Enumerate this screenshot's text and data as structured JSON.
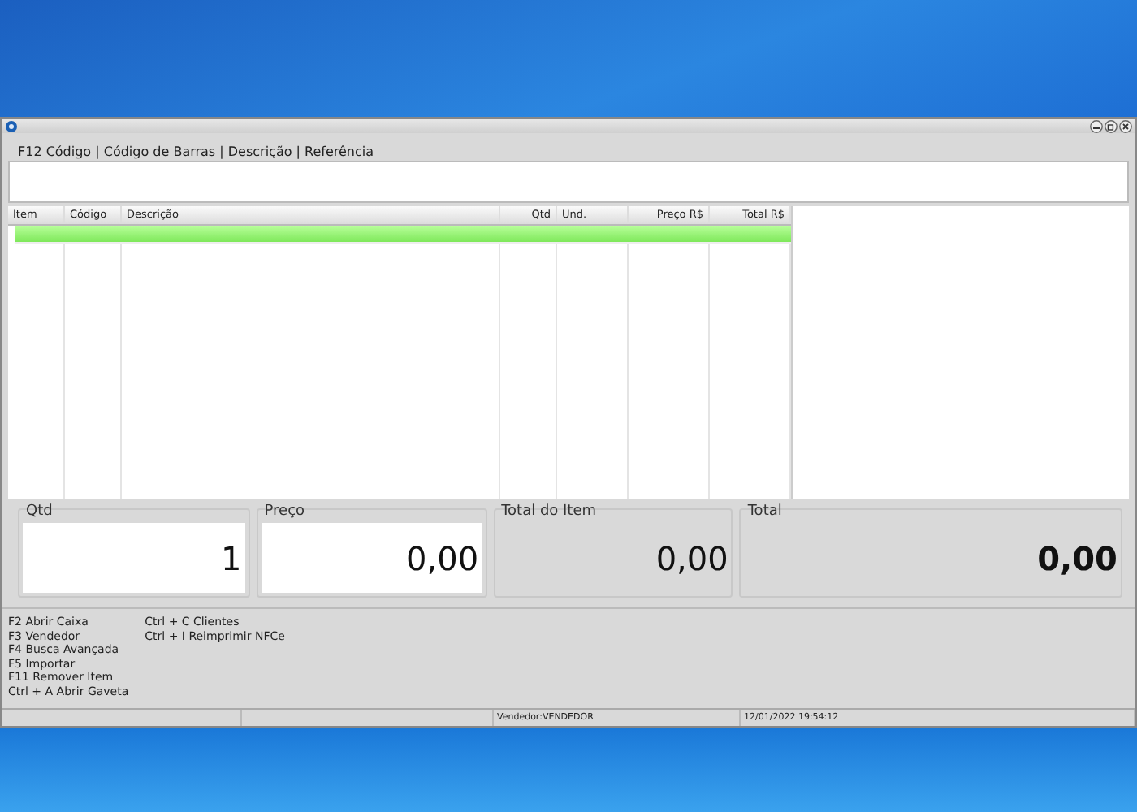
{
  "search": {
    "label": "F12  Código | Código de Barras | Descrição | Referência"
  },
  "table": {
    "columns": [
      "Item",
      "Código",
      "Descrição",
      "Qtd",
      "Und.",
      "Preço R$",
      "Total R$"
    ],
    "rows": [
      {
        "selected": true
      }
    ]
  },
  "fields": [
    {
      "label": "Qtd",
      "value": "1",
      "kind": "input",
      "bold": false
    },
    {
      "label": "Preço",
      "value": "0,00",
      "kind": "input",
      "bold": false
    },
    {
      "label": "Total do Item",
      "value": "0,00",
      "kind": "display",
      "bold": false
    },
    {
      "label": "Total",
      "value": "0,00",
      "kind": "display",
      "bold": true
    }
  ],
  "shortcuts": [
    [
      "F2 Abrir Caixa",
      "F3 Vendedor",
      "F4 Busca Avançada",
      "F5 Importar",
      "F11 Remover Item",
      "Ctrl + A  Abrir Gaveta"
    ],
    [
      "Ctrl + C  Clientes",
      "Ctrl + I  Reimprimir NFCe"
    ]
  ],
  "status_bar": {
    "vendor": "Vendedor:VENDEDOR",
    "datetime": "12/01/2022 19:54:12"
  }
}
